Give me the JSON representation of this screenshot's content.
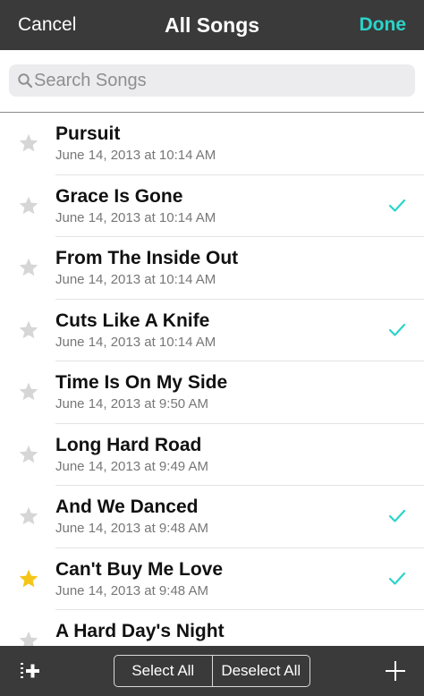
{
  "nav": {
    "left_label": "Cancel",
    "title": "All Songs",
    "right_label": "Done"
  },
  "search": {
    "placeholder": "Search Songs",
    "value": ""
  },
  "songs": [
    {
      "title": "Pursuit",
      "date": "June 14, 2013 at 10:14 AM",
      "starred": false,
      "checked": false
    },
    {
      "title": "Grace Is Gone",
      "date": "June 14, 2013 at 10:14 AM",
      "starred": false,
      "checked": true
    },
    {
      "title": "From The Inside Out",
      "date": "June 14, 2013 at 10:14 AM",
      "starred": false,
      "checked": false
    },
    {
      "title": "Cuts Like A Knife",
      "date": "June 14, 2013 at 10:14 AM",
      "starred": false,
      "checked": true
    },
    {
      "title": "Time Is On My Side",
      "date": "June 14, 2013 at 9:50 AM",
      "starred": false,
      "checked": false
    },
    {
      "title": "Long Hard Road",
      "date": "June 14, 2013 at 9:49 AM",
      "starred": false,
      "checked": false
    },
    {
      "title": "And We Danced",
      "date": "June 14, 2013 at 9:48 AM",
      "starred": false,
      "checked": true
    },
    {
      "title": "Can't Buy Me Love",
      "date": "June 14, 2013 at 9:48 AM",
      "starred": true,
      "checked": true
    },
    {
      "title": "A Hard Day's Night",
      "date": "",
      "starred": false,
      "checked": false
    }
  ],
  "toolbar": {
    "select_all_label": "Select All",
    "deselect_all_label": "Deselect All",
    "add_to_list_icon": "add-to-list-icon",
    "plus_icon": "plus-icon"
  },
  "colors": {
    "accent": "#2ad4c9",
    "bar": "#3a3a3a",
    "star_on": "#f5c518",
    "star_off": "#d6d6d6"
  }
}
